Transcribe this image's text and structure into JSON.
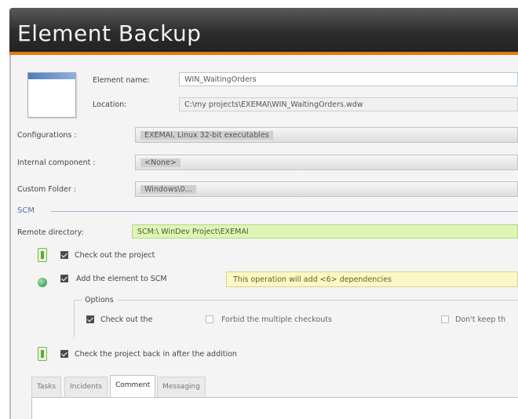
{
  "window": {
    "title": "Element Backup"
  },
  "element": {
    "name_label": "Element name:",
    "name_value": "WIN_WaitingOrders",
    "location_label": "Location:",
    "location_value": "C:\\my projects\\EXEMAI\\WIN_WaitingOrders.wdw"
  },
  "configurations": {
    "label": "Configurations :",
    "value": "EXEMAI, Linux 32-bit executables"
  },
  "internal_component": {
    "label": "Internal component :",
    "value": "<None>"
  },
  "custom_folder": {
    "label": "Custom Folder :",
    "value": "Windows\\0..."
  },
  "scm": {
    "section_label": "SCM",
    "remote_directory_label": "Remote directory:",
    "remote_directory_value": "SCM:\\ WinDev Project\\EXEMAI"
  },
  "checks": {
    "check_out_project": {
      "label": "Check out the project",
      "checked": true
    },
    "add_element": {
      "label": "Add the element to SCM",
      "checked": true
    },
    "add_element_note": "This operation will add <6> dependencies",
    "check_back_in": {
      "label": "Check the project back in after the addition",
      "checked": true
    }
  },
  "options": {
    "label": "Options",
    "items": [
      {
        "label": "Check out the",
        "checked": true
      },
      {
        "label": "Forbid the multiple checkouts",
        "checked": false
      },
      {
        "label": "Don't keep th",
        "checked": false
      }
    ]
  },
  "tabs": [
    {
      "label": "Tasks",
      "active": false
    },
    {
      "label": "Incidents",
      "active": false
    },
    {
      "label": "Comment",
      "active": true
    },
    {
      "label": "Messaging",
      "active": false
    }
  ],
  "colors": {
    "accent_orange": "#e07b10",
    "title_bar": "#2d2d2d",
    "remote_field_green": "#dff5b4",
    "note_yellow": "#fbf7c6",
    "scm_blue": "#5a6fb0"
  }
}
